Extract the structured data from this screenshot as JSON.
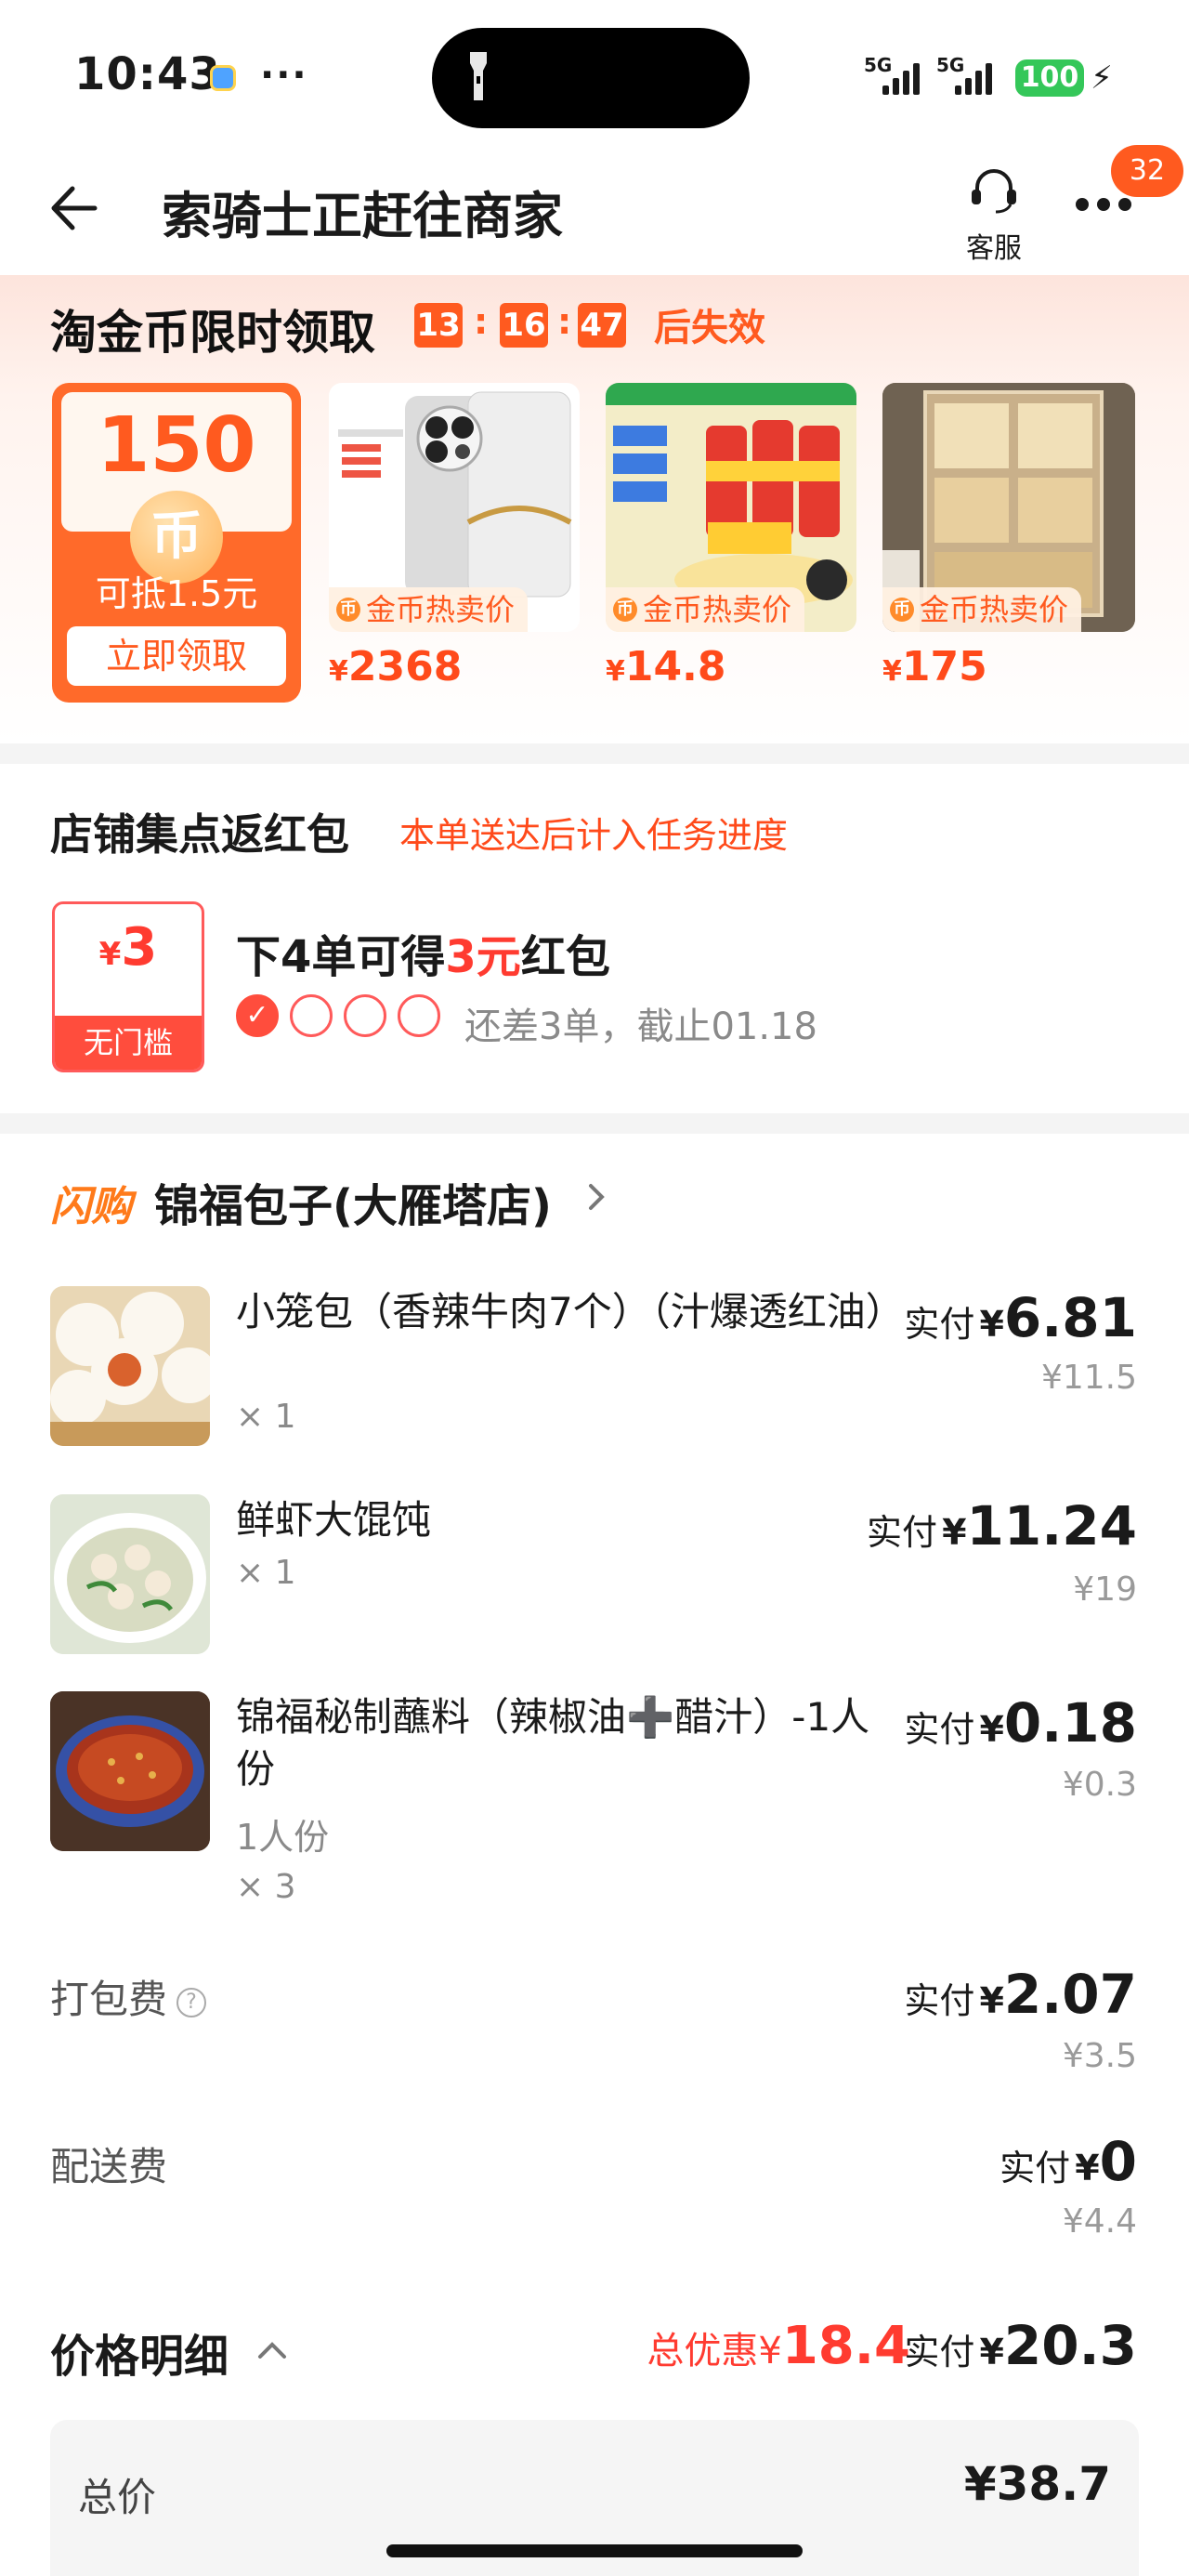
{
  "status_bar": {
    "time": "10:43",
    "dots": "···",
    "signal1_label": "5G",
    "signal2_label": "5G",
    "battery": "100",
    "bolt": "⚡"
  },
  "header": {
    "title": "索骑士正赶往商家",
    "service_label": "客服",
    "badge_count": "32"
  },
  "coin_banner": {
    "title": "淘金币限时领取",
    "countdown": [
      "13",
      "16",
      "47"
    ],
    "countdown_sep": ":",
    "suffix": "后失效",
    "coupon": {
      "amount": "150",
      "coin_glyph": "币",
      "subtitle": "可抵1.5元",
      "button": "立即领取"
    },
    "tag_coin_glyph": "币",
    "products": [
      {
        "tag": "金币热卖价",
        "currency": "¥",
        "price": "2368",
        "image": "phone"
      },
      {
        "tag": "金币热卖价",
        "currency": "¥",
        "price": "14.8",
        "image": "snacks"
      },
      {
        "tag": "金币热卖价",
        "currency": "¥",
        "price": "175",
        "image": "cabinet"
      }
    ]
  },
  "store_points": {
    "title": "店铺集点返红包",
    "note": "本单送达后计入任务进度",
    "coupon_currency": "¥",
    "coupon_amount": "3",
    "coupon_label": "无门槛",
    "headline_pre": "下4单可得",
    "headline_hl": "3元",
    "headline_post": "红包",
    "progress_done": 1,
    "progress_total": 4,
    "remaining": "还差3单，截止01.18"
  },
  "shop": {
    "flash_label": "闪购",
    "name": "锦福包子(大雁塔店)"
  },
  "items": [
    {
      "name": "小笼包（香辣牛肉7个）（汁爆透红油）",
      "spec": "",
      "qty": "× 1",
      "pay_label": "实付",
      "currency": "¥",
      "pay": "6.81",
      "orig": "¥11.5",
      "image": "buns"
    },
    {
      "name": "鲜虾大馄饨",
      "spec": "",
      "qty": "× 1",
      "pay_label": "实付",
      "currency": "¥",
      "pay": "11.24",
      "orig": "¥19",
      "image": "wonton"
    },
    {
      "name": "锦福秘制蘸料（辣椒油➕醋汁）-1人份",
      "spec": "1人份",
      "qty": "× 3",
      "pay_label": "实付",
      "currency": "¥",
      "pay": "0.18",
      "orig": "¥0.3",
      "image": "sauce"
    }
  ],
  "fees": [
    {
      "label": "打包费",
      "has_help": true,
      "pay_label": "实付",
      "currency": "¥",
      "pay": "2.07",
      "orig": "¥3.5"
    },
    {
      "label": "配送费",
      "has_help": false,
      "pay_label": "实付",
      "currency": "¥",
      "pay": "0",
      "orig": "¥4.4"
    }
  ],
  "price_detail": {
    "title": "价格明细",
    "discount_label": "总优惠",
    "discount_currency": "¥",
    "discount": "18.4",
    "pay_label": "实付",
    "pay_currency": "¥",
    "pay": "20.3",
    "total_label": "总价",
    "total": "¥38.7"
  },
  "colors": {
    "accent": "#ff5a1f",
    "red": "#ff3b30",
    "battery": "#34c759"
  }
}
